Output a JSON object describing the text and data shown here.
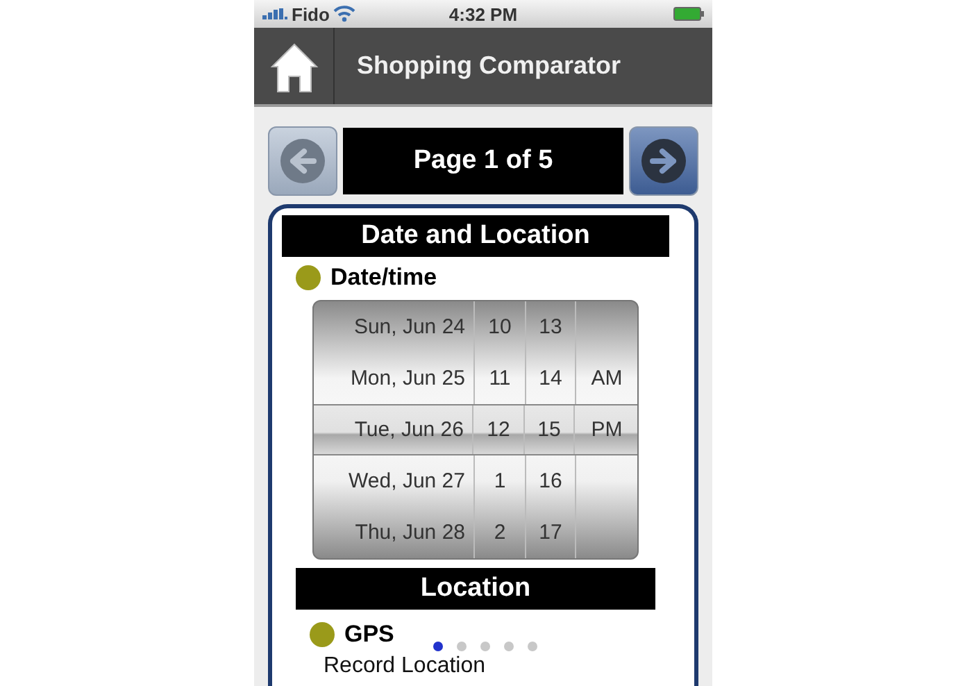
{
  "status_bar": {
    "carrier": "Fido",
    "time": "4:32 PM"
  },
  "header": {
    "title": "Shopping Comparator"
  },
  "pager": {
    "label": "Page 1 of 5",
    "prev_disabled": true,
    "next_disabled": false
  },
  "section": {
    "title": "Date and Location"
  },
  "date_time": {
    "label": "Date/time",
    "color": "#9a9a1a",
    "picker_rows": [
      {
        "date": "Sun, Jun 24",
        "hour": "10",
        "minute": "13",
        "selected": false
      },
      {
        "date": "Mon, Jun 25",
        "hour": "11",
        "minute": "14",
        "ampm": "AM",
        "selected": false
      },
      {
        "date": "Tue, Jun 26",
        "hour": "12",
        "minute": "15",
        "ampm": "PM",
        "selected": true
      },
      {
        "date": "Wed, Jun 27",
        "hour": "1",
        "minute": "16",
        "selected": false
      },
      {
        "date": "Thu, Jun 28",
        "hour": "2",
        "minute": "17",
        "selected": false
      }
    ]
  },
  "location": {
    "title": "Location",
    "gps_label": "GPS",
    "color": "#9a9a1a",
    "record_label": "Record Location"
  },
  "page_dots": [
    {
      "selected": true
    },
    {
      "selected": false
    },
    {
      "selected": false
    },
    {
      "selected": false
    },
    {
      "selected": false
    }
  ]
}
